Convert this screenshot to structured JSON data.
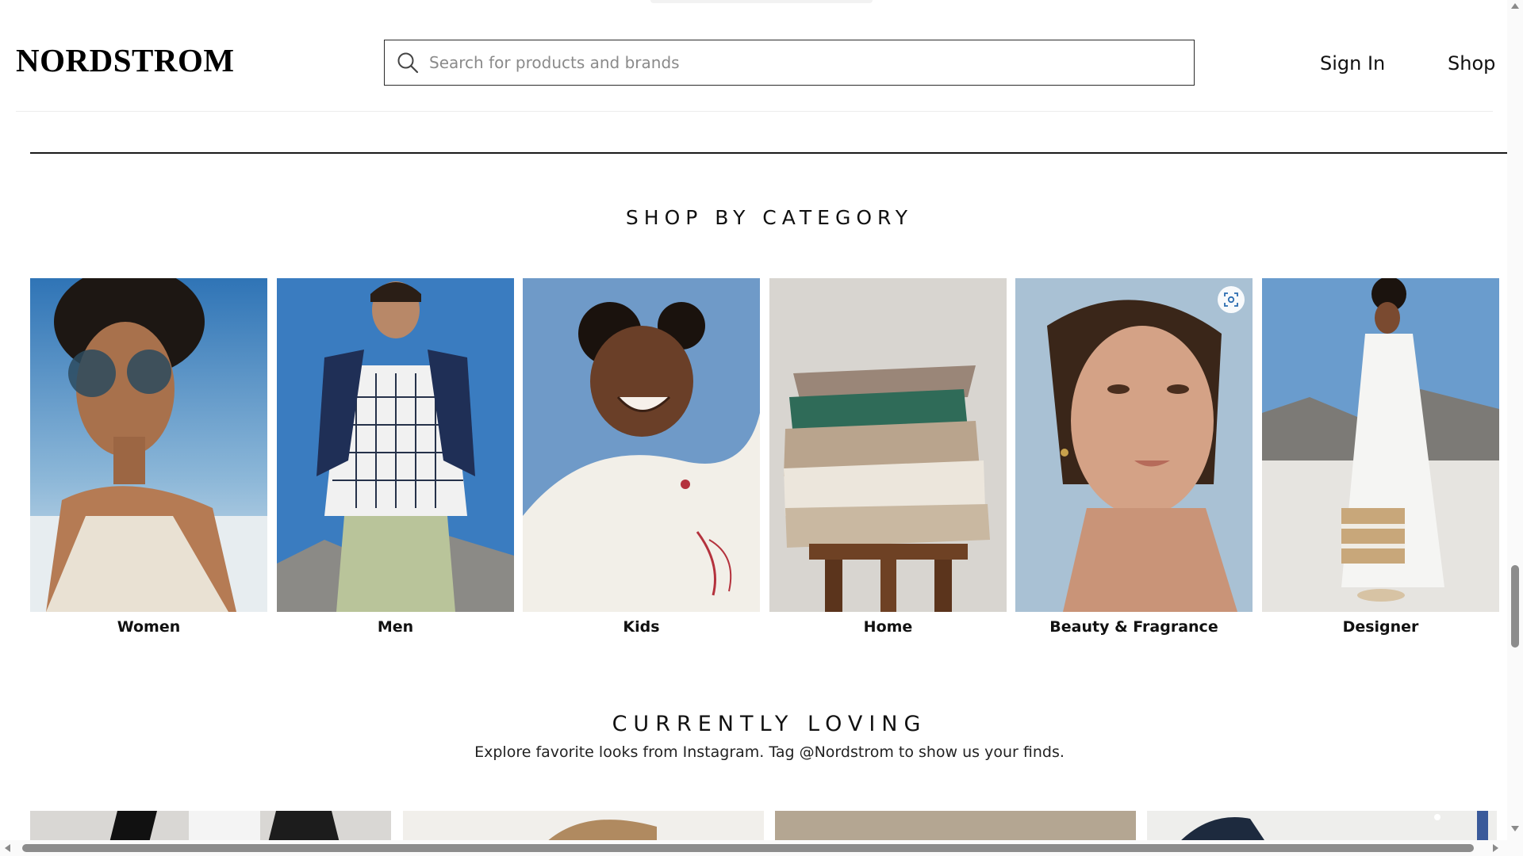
{
  "header": {
    "logo": "NORDSTROM",
    "search_placeholder": "Search for products and brands",
    "sign_in": "Sign In",
    "shop": "Shop"
  },
  "shop_by_category": {
    "heading": "SHOP BY CATEGORY",
    "items": [
      {
        "label": "Women",
        "image": "woman-in-sunglasses-photo"
      },
      {
        "label": "Men",
        "image": "man-in-grid-polo-photo"
      },
      {
        "label": "Kids",
        "image": "smiling-child-photo"
      },
      {
        "label": "Home",
        "image": "folded-blankets-on-stool-photo"
      },
      {
        "label": "Beauty & Fragrance",
        "image": "woman-portrait-photo"
      },
      {
        "label": "Designer",
        "image": "woman-in-white-dress-with-tote-photo"
      }
    ],
    "visual_search_icon": "visual-search-icon"
  },
  "currently_loving": {
    "heading": "CURRENTLY LOVING",
    "subtitle": "Explore favorite looks from Instagram. Tag @Nordstrom to show us your finds."
  },
  "colors": {
    "text": "#111111",
    "rule": "#1a1a1a",
    "scrollbar_thumb": "#8c8c8c"
  }
}
